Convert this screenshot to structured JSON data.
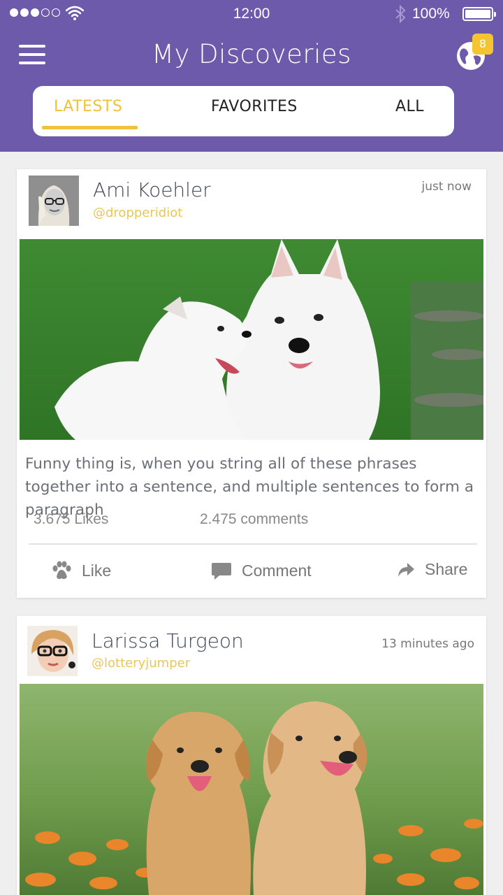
{
  "status_bar": {
    "time": "12:00",
    "battery": "100%"
  },
  "header": {
    "title": "My Discoveries",
    "notification_count": "8"
  },
  "tabs": [
    {
      "label": "LATESTS",
      "active": true
    },
    {
      "label": "FAVORITES",
      "active": false
    },
    {
      "label": "ALL",
      "active": false
    }
  ],
  "posts": [
    {
      "name": "Ami Koehler",
      "handle": "@dropperidiot",
      "time": "just now",
      "caption": "Funny thing is, when you string all of these phrases together into a sentence, and multiple sentences to form a paragraph",
      "likes": "3.675 Likes",
      "comments": "2.475 comments"
    },
    {
      "name": "Larissa Turgeon",
      "handle": "@lotteryjumper",
      "time": "13 minutes ago"
    }
  ],
  "actions": {
    "like": "Like",
    "comment": "Comment",
    "share": "Share"
  },
  "colors": {
    "header_bg": "#6e5aab",
    "accent": "#f0c13a",
    "badge": "#f5c431"
  }
}
